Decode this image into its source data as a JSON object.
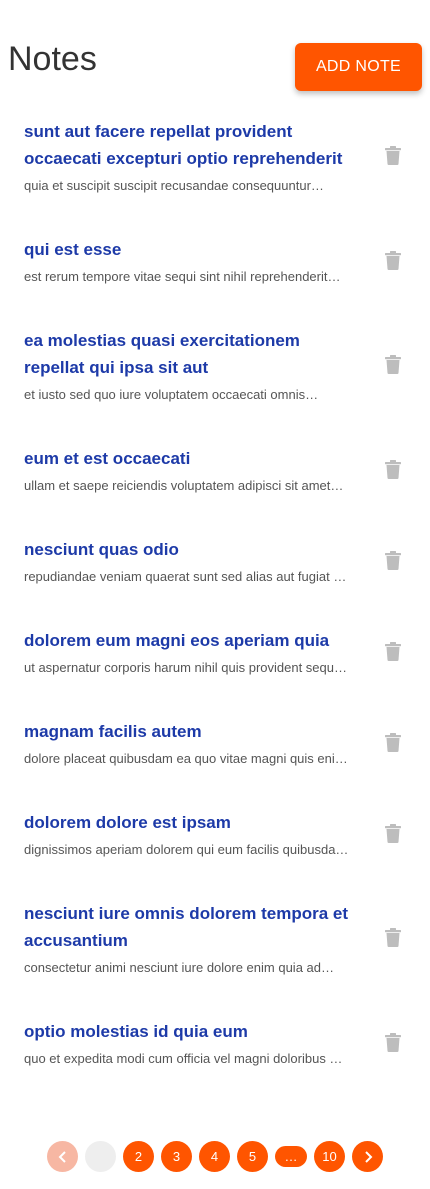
{
  "header": {
    "title": "Notes",
    "add_label": "ADD NOTE"
  },
  "colors": {
    "accent": "#ff5500",
    "link": "#1d3aa8",
    "muted": "#555555",
    "trash": "#bdbdbd"
  },
  "notes": [
    {
      "title_lines": [
        "sunt aut facere repellat provident",
        "occaecati excepturi optio reprehenderit"
      ],
      "body": "quia et suscipit suscipit recusandae consequuntur…"
    },
    {
      "title_lines": [
        "qui est esse"
      ],
      "body": "est rerum tempore vitae sequi sint nihil reprehenderit…"
    },
    {
      "title_lines": [
        "ea molestias quasi exercitationem",
        "repellat qui ipsa sit aut"
      ],
      "body": "et iusto sed quo iure voluptatem occaecati omnis…"
    },
    {
      "title_lines": [
        "eum et est occaecati"
      ],
      "body": "ullam et saepe reiciendis voluptatem adipisci sit amet…"
    },
    {
      "title_lines": [
        "nesciunt quas odio"
      ],
      "body": "repudiandae veniam quaerat sunt sed alias aut fugiat …"
    },
    {
      "title_lines": [
        "dolorem eum magni eos aperiam quia"
      ],
      "body": "ut aspernatur corporis harum nihil quis provident sequ…"
    },
    {
      "title_lines": [
        "magnam facilis autem"
      ],
      "body": "dolore placeat quibusdam ea quo vitae magni quis eni…"
    },
    {
      "title_lines": [
        "dolorem dolore est ipsam"
      ],
      "body": "dignissimos aperiam dolorem qui eum facilis quibusda…"
    },
    {
      "title_lines": [
        "nesciunt iure omnis dolorem tempora et",
        "accusantium"
      ],
      "body": "consectetur animi nesciunt iure dolore enim quia ad…"
    },
    {
      "title_lines": [
        "optio molestias id quia eum"
      ],
      "body": "quo et expedita modi cum officia vel magni doloribus …"
    }
  ],
  "pagination": {
    "prev_icon": "chevron-left-icon",
    "next_icon": "chevron-right-icon",
    "current_page": "1",
    "pages": [
      "2",
      "3",
      "4",
      "5"
    ],
    "ellipsis": "…",
    "last_page": "10"
  }
}
